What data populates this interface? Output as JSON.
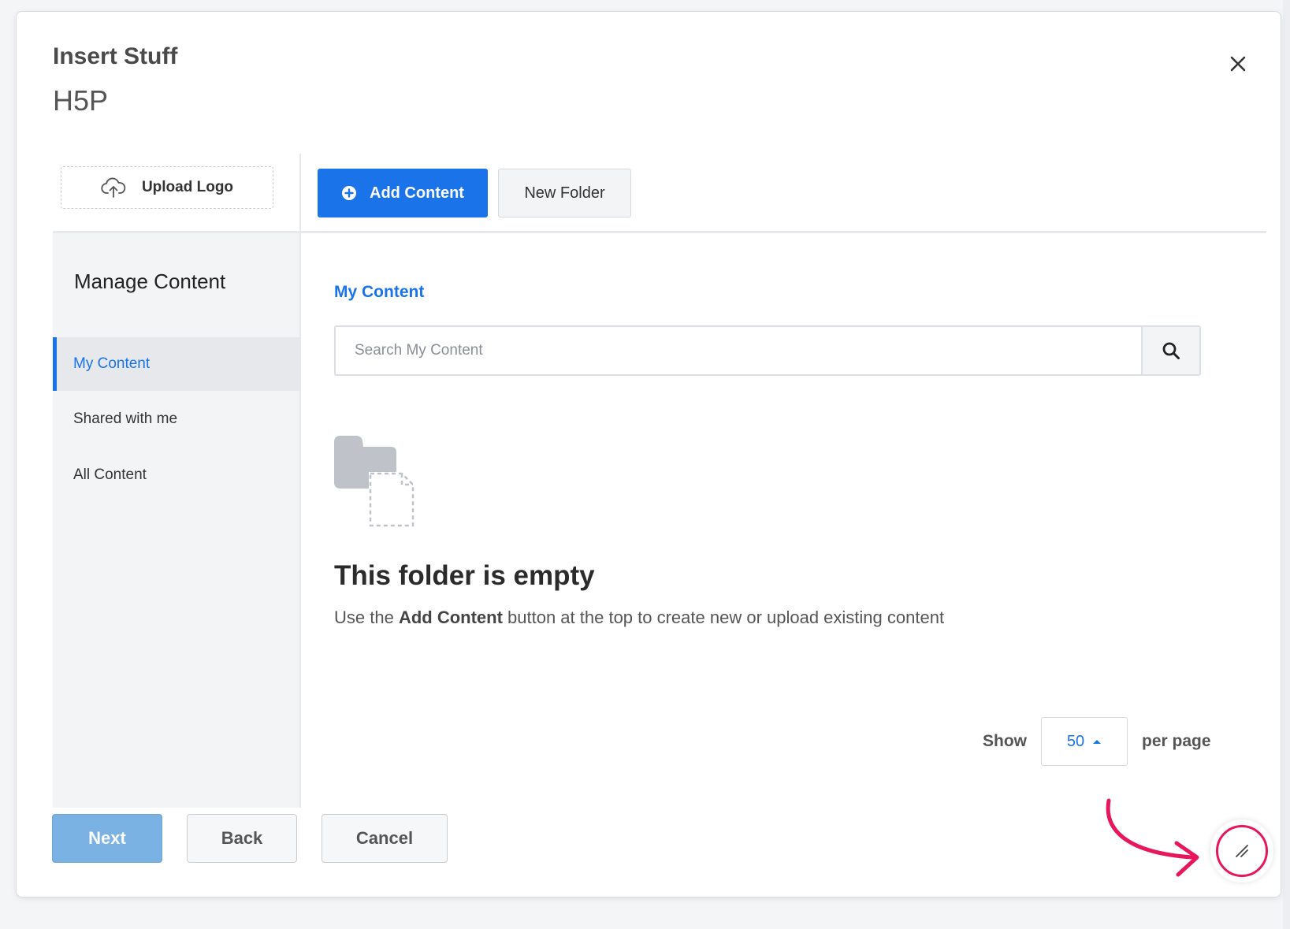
{
  "dialog": {
    "title": "Insert Stuff",
    "subtitle": "H5P",
    "close_icon": "close-icon"
  },
  "toolbar": {
    "upload_logo_label": "Upload Logo",
    "upload_icon": "cloud-upload-icon",
    "add_content_label": "Add Content",
    "add_icon": "plus-circle-icon",
    "new_folder_label": "New Folder"
  },
  "sidebar": {
    "heading": "Manage Content",
    "items": [
      {
        "label": "My Content",
        "active": true
      },
      {
        "label": "Shared with me",
        "active": false
      },
      {
        "label": "All Content",
        "active": false
      }
    ]
  },
  "main": {
    "heading": "My Content",
    "search": {
      "placeholder": "Search My Content",
      "icon": "search-icon"
    },
    "empty": {
      "icon": "empty-folder-icon",
      "title": "This folder is empty",
      "desc_prefix": "Use the ",
      "desc_bold": "Add Content",
      "desc_suffix": " button at the top to create new or upload existing content"
    },
    "pager": {
      "show_label": "Show",
      "per_page_value": "50",
      "per_page_label": "per page"
    }
  },
  "footer": {
    "next_label": "Next",
    "back_label": "Back",
    "cancel_label": "Cancel"
  },
  "colors": {
    "accent": "#1a73e8",
    "next_disabled": "#7ab2e3",
    "annotation": "#e8175d"
  }
}
